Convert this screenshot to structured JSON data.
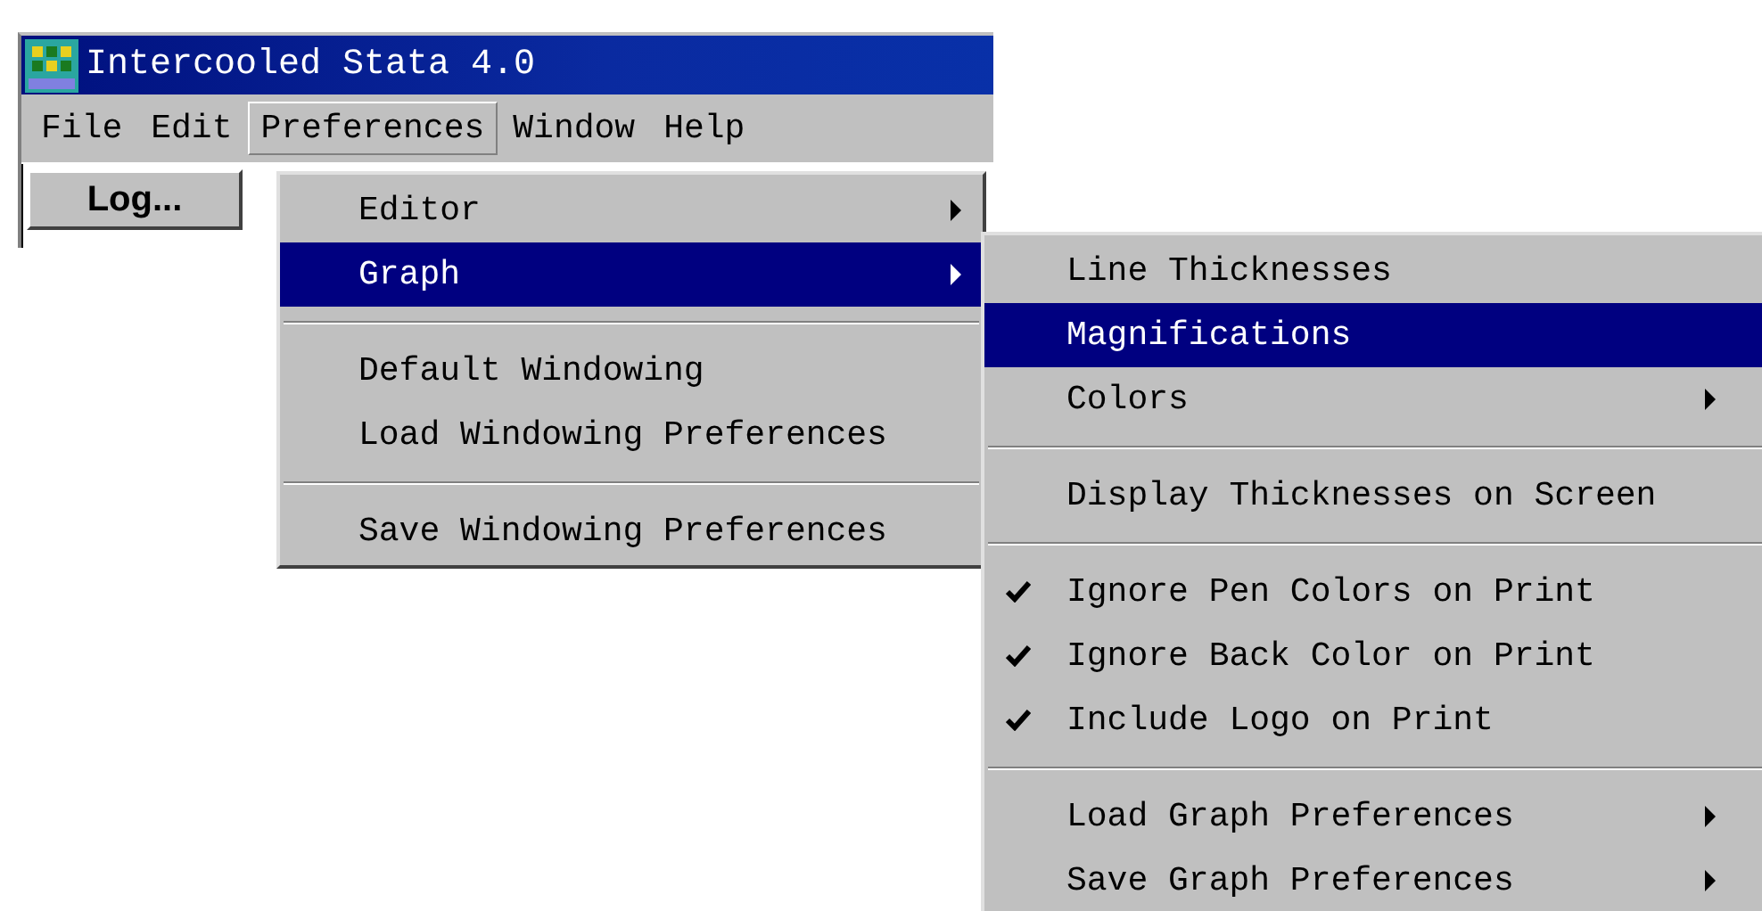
{
  "window": {
    "title": "Intercooled Stata 4.0"
  },
  "menubar": [
    {
      "label": "File",
      "selected": false
    },
    {
      "label": "Edit",
      "selected": false
    },
    {
      "label": "Preferences",
      "selected": true
    },
    {
      "label": "Window",
      "selected": false
    },
    {
      "label": "Help",
      "selected": false
    }
  ],
  "toolbar": {
    "button": "Log..."
  },
  "preferences_menu": [
    {
      "kind": "item",
      "label": "Editor",
      "submenu": true,
      "selected": false
    },
    {
      "kind": "item",
      "label": "Graph",
      "submenu": true,
      "selected": true
    },
    {
      "kind": "separator"
    },
    {
      "kind": "item",
      "label": "Default Windowing",
      "submenu": false,
      "selected": false
    },
    {
      "kind": "item",
      "label": "Load Windowing Preferences",
      "submenu": false,
      "selected": false
    },
    {
      "kind": "separator"
    },
    {
      "kind": "item",
      "label": "Save Windowing Preferences",
      "submenu": false,
      "selected": false
    }
  ],
  "graph_menu": [
    {
      "kind": "item",
      "label": "Line Thicknesses",
      "submenu": false,
      "selected": false,
      "checked": false
    },
    {
      "kind": "item",
      "label": "Magnifications",
      "submenu": false,
      "selected": true,
      "checked": false
    },
    {
      "kind": "item",
      "label": "Colors",
      "submenu": true,
      "selected": false,
      "checked": false
    },
    {
      "kind": "separator"
    },
    {
      "kind": "item",
      "label": "Display Thicknesses on Screen",
      "submenu": false,
      "selected": false,
      "checked": false
    },
    {
      "kind": "separator"
    },
    {
      "kind": "item",
      "label": "Ignore Pen Colors on Print",
      "submenu": false,
      "selected": false,
      "checked": true
    },
    {
      "kind": "item",
      "label": "Ignore Back Color on Print",
      "submenu": false,
      "selected": false,
      "checked": true
    },
    {
      "kind": "item",
      "label": "Include Logo on Print",
      "submenu": false,
      "selected": false,
      "checked": true
    },
    {
      "kind": "separator"
    },
    {
      "kind": "item",
      "label": "Load Graph Preferences",
      "submenu": true,
      "selected": false,
      "checked": false
    },
    {
      "kind": "item",
      "label": "Save Graph Preferences",
      "submenu": true,
      "selected": false,
      "checked": false
    }
  ]
}
